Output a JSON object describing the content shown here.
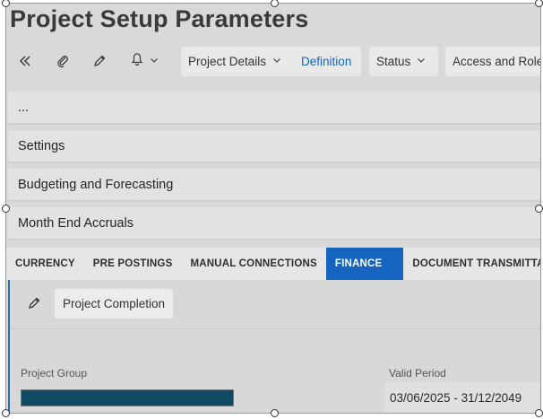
{
  "page": {
    "title": "Project Setup Parameters"
  },
  "toolbar": {
    "collapse_icon": "double-chevron-left-icon",
    "attach_icon": "paperclip-icon",
    "edit_icon": "pencil-icon",
    "bell_icon": "bell-icon",
    "project_details_label": "Project Details",
    "definition_label": "Definition",
    "status_label": "Status",
    "access_label": "Access and Roles"
  },
  "sections": [
    {
      "label": "..."
    },
    {
      "label": "Settings"
    },
    {
      "label": "Budgeting and Forecasting"
    },
    {
      "label": "Month End Accruals"
    }
  ],
  "tabs": [
    {
      "label": "CURRENCY",
      "active": false
    },
    {
      "label": "PRE POSTINGS",
      "active": false
    },
    {
      "label": "MANUAL CONNECTIONS",
      "active": false
    },
    {
      "label": "FINANCE",
      "active": true
    },
    {
      "label": "DOCUMENT TRANSMITTAL",
      "active": false
    }
  ],
  "content": {
    "project_completion_label": "Project Completion",
    "project_group_label": "Project Group",
    "project_group_value": "",
    "valid_period_label": "Valid Period",
    "valid_period_value": "03/06/2025 - 31/12/2049"
  },
  "colors": {
    "accent": "#1565c0",
    "project_group_fill": "#0e4a63",
    "background": "#d9d9d9"
  }
}
